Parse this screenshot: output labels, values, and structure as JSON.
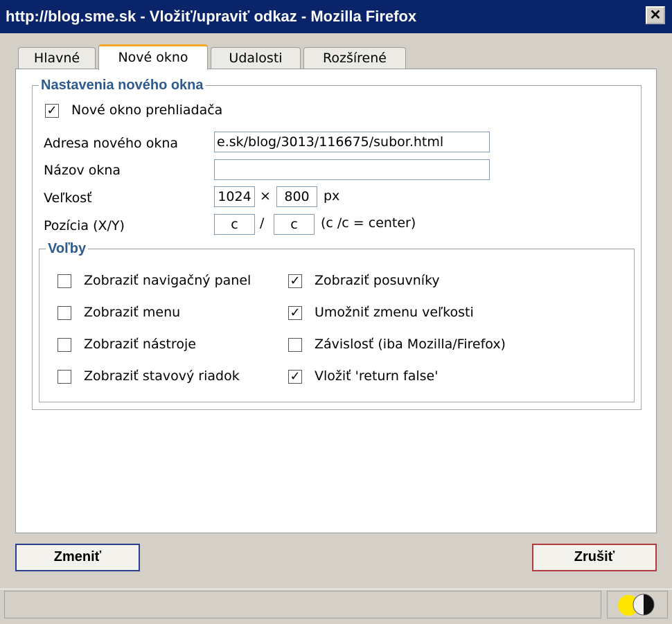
{
  "window": {
    "title": "http://blog.sme.sk - Vložiť/upraviť odkaz - Mozilla Firefox",
    "close_glyph": "✕"
  },
  "tabs": [
    {
      "label": "Hlavné",
      "active": false
    },
    {
      "label": "Nové okno",
      "active": true
    },
    {
      "label": "Udalosti",
      "active": false
    },
    {
      "label": "Rozšírené",
      "active": false
    }
  ],
  "new_window": {
    "legend": "Nastavenia nového okna",
    "browser_window_label": "Nové okno prehliadača",
    "browser_window_checked": true,
    "address_label": "Adresa nového okna",
    "address_value": "e.sk/blog/3013/116675/subor.html",
    "name_label": "Názov okna",
    "name_value": "",
    "size_label": "Veľkosť",
    "width_value": "1024",
    "times": "×",
    "height_value": "800",
    "px": "px",
    "position_label": "Pozícia (X/Y)",
    "pos_x_value": "c",
    "slash": "/",
    "pos_y_value": "c",
    "center_hint": "(c /c = center)"
  },
  "options": {
    "legend": "Voľby",
    "items": [
      {
        "label": "Zobraziť navigačný panel",
        "checked": false
      },
      {
        "label": "Zobraziť posuvníky",
        "checked": true
      },
      {
        "label": "Zobraziť menu",
        "checked": false
      },
      {
        "label": "Umožniť zmenu veľkosti",
        "checked": true
      },
      {
        "label": "Zobraziť nástroje",
        "checked": false
      },
      {
        "label": "Závislosť (iba Mozilla/Firefox)",
        "checked": false
      },
      {
        "label": "Zobraziť stavový riadok",
        "checked": false
      },
      {
        "label": "Vložiť 'return false'",
        "checked": true
      }
    ]
  },
  "buttons": {
    "ok": "Zmeniť",
    "cancel": "Zrušiť"
  },
  "check_glyph": "✓",
  "colors": {
    "titlebar": "#0a246a",
    "legend": "#2c5b8c",
    "active_tab": "#f5a623"
  }
}
